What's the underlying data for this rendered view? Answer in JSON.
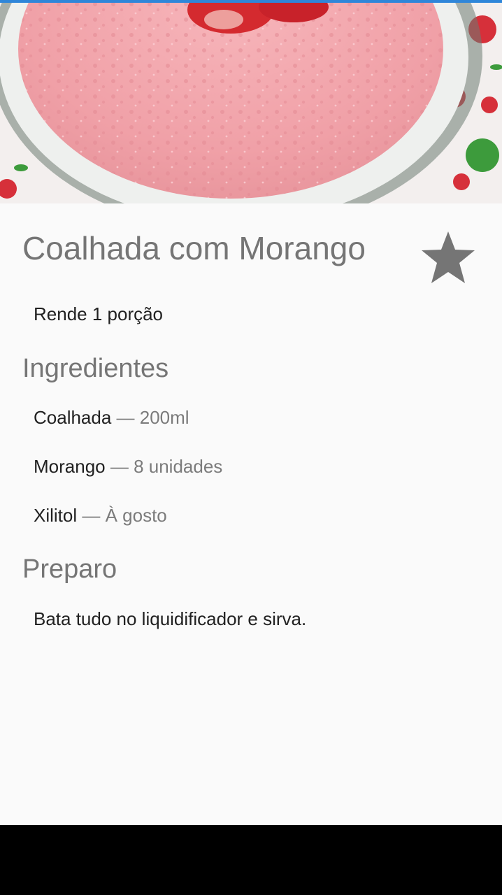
{
  "recipe": {
    "title": "Coalhada com Morango",
    "yield": "Rende 1 porção",
    "favorite_icon": "star-icon",
    "ingredients_heading": "Ingredientes",
    "ingredients": [
      {
        "name": "Coalhada",
        "separator": " — ",
        "quantity": "200ml"
      },
      {
        "name": "Morango",
        "separator": " — ",
        "quantity": "8 unidades"
      },
      {
        "name": "Xilitol",
        "separator": " — ",
        "quantity": "À gosto"
      }
    ],
    "preparation_heading": "Preparo",
    "preparation_steps": [
      "Bata tudo no liquidificador e sirva."
    ]
  },
  "colors": {
    "title_gray": "#757575",
    "text_dark": "#212121",
    "star_gray": "#757575",
    "smoothie_pink": "#f2a3a9",
    "status_accent": "#2f86d9"
  }
}
